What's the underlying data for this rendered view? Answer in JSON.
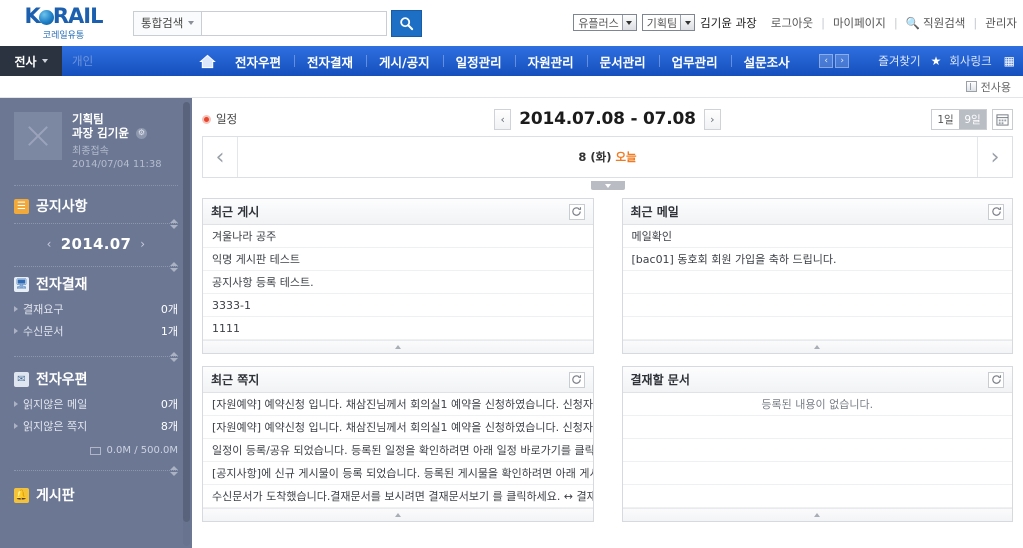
{
  "brand": {
    "logo_text": "KORAIL",
    "logo_o": "O",
    "logo_pre": "K",
    "logo_post": "RAIL",
    "logo_sub": "코레일유통"
  },
  "search": {
    "category": "통합검색",
    "value": "",
    "placeholder": "",
    "button_icon": "search-icon"
  },
  "utility": {
    "company_select": "유플러스",
    "team_select": "기획팀",
    "user": "김기윤 과장",
    "logout": "로그아웃",
    "mypage": "마이페이지",
    "staff_search": "직원검색",
    "admin": "관리자",
    "sep": "|"
  },
  "nav": {
    "corp": "전사",
    "personal": "개인",
    "home_icon": "home-icon",
    "items": [
      {
        "label": "전자우편"
      },
      {
        "label": "전자결재"
      },
      {
        "label": "게시/공지"
      },
      {
        "label": "일정관리"
      },
      {
        "label": "자원관리"
      },
      {
        "label": "문서관리"
      },
      {
        "label": "업무관리"
      },
      {
        "label": "설문조사"
      }
    ],
    "prev_arrow": "‹",
    "next_arrow": "›",
    "favorites": "즐겨찾기",
    "star": "★",
    "corp_link": "회사링크",
    "grid_icon": "grid-icon"
  },
  "substrip": {
    "label": "전사용"
  },
  "sidebar": {
    "user": {
      "team": "기획팀",
      "name": "과장 김기윤",
      "gear_icon": "gear-icon",
      "last_login_label": "최종접속",
      "last_login_time": "2014/07/04 11:38"
    },
    "sections": [
      {
        "title": "공지사항",
        "icon": "notice-icon"
      },
      {
        "title": "전자결재",
        "icon": "approval-icon",
        "rows": [
          {
            "label": "결재요구",
            "count": "0개"
          },
          {
            "label": "수신문서",
            "count": "1개"
          }
        ]
      },
      {
        "title": "전자우편",
        "icon": "mail-icon",
        "rows": [
          {
            "label": "읽지않은 메일",
            "count": "0개"
          },
          {
            "label": "읽지않은 쪽지",
            "count": "8개"
          }
        ],
        "quota": "0.0M / 500.0M"
      },
      {
        "title": "게시판",
        "icon": "board-icon"
      }
    ],
    "month": {
      "prev": "‹",
      "value": "2014.07",
      "next": "›"
    }
  },
  "main": {
    "schedule_tag": "일정",
    "date_prev": "‹",
    "date_range": "2014.07.08 - 07.08",
    "date_next": "›",
    "view_day": "1일",
    "view_multi": "9일",
    "calendar_icon": "calendar-icon",
    "day_prev": "‹",
    "day_next": "›",
    "day_label": "8 (화)",
    "day_today": "오늘",
    "panels": {
      "recent_posts": {
        "title": "최근 게시",
        "refresh_icon": "refresh-icon",
        "rows": [
          "겨울나라 공주",
          "익명 게시판 테스트",
          "공지사항 등록 테스트.",
          "3333-1",
          "1111"
        ]
      },
      "recent_mail": {
        "title": "최근 메일",
        "refresh_icon": "refresh-icon",
        "rows": [
          "메일확인",
          "[bac01] 동호회 회원 가입을 축하 드립니다.",
          "",
          "",
          ""
        ]
      },
      "recent_notes": {
        "title": "최근 쪽지",
        "refresh_icon": "refresh-icon",
        "rows": [
          "[자원예약] 예약신청 입니다.  채삼진님께서 회의실1 예약을 신청하였습니다.  신청자 :",
          "[자원예약] 예약신청 입니다.  채삼진님께서 회의실1 예약을 신청하였습니다.  신청자 :",
          "일정이 등록/공유 되었습니다.  등록된 일정을 확인하려면 아래 일정 바로가기를 클릭",
          "[공지사항]에 신규 게시물이 등록 되었습니다.  등록된 게시물을 확인하려면 아래 게시",
          "수신문서가 도착했습니다.결재문서를 보시려면 결재문서보기 를 클릭하세요. ↔ 결재문"
        ]
      },
      "approval_docs": {
        "title": "결재할 문서",
        "refresh_icon": "refresh-icon",
        "empty_message": "등록된 내용이 없습니다.",
        "rows": [
          "",
          "",
          ""
        ]
      }
    }
  },
  "colors": {
    "brand_blue": "#1b5fae",
    "nav_blue": "#1c60d6",
    "sidebar": "#6b7793",
    "today_orange": "#ef7a21",
    "schedule_red": "#e8452c"
  }
}
